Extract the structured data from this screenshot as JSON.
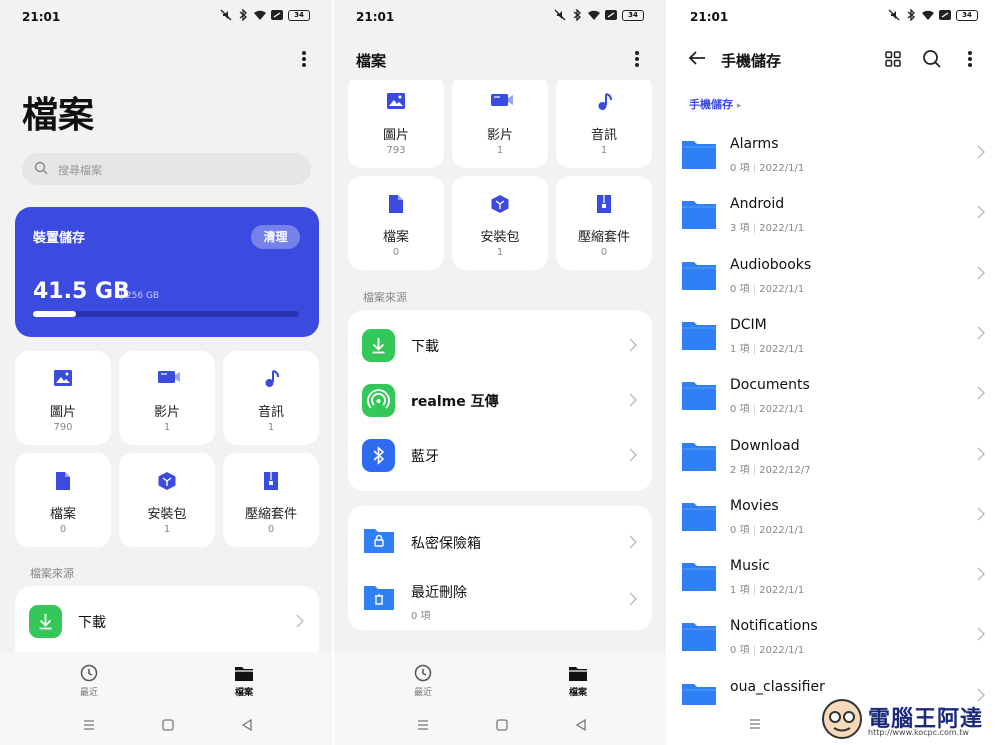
{
  "status": {
    "time": "21:01",
    "battery": "34"
  },
  "colors": {
    "accent": "#3b4be0",
    "green": "#34c759",
    "blue": "#2f6bf0",
    "folder": "#2f7ff5"
  },
  "files_home": {
    "title": "檔案",
    "search_placeholder": "搜尋檔案",
    "storage": {
      "label": "裝置儲存",
      "clean": "清理",
      "used": "41.5 GB",
      "total": "256 GB",
      "used_fraction": 0.162
    },
    "categories": [
      {
        "label": "圖片",
        "count": "790",
        "icon": "image-icon"
      },
      {
        "label": "影片",
        "count": "1",
        "icon": "video-icon"
      },
      {
        "label": "音訊",
        "count": "1",
        "icon": "music-note-icon"
      },
      {
        "label": "檔案",
        "count": "0",
        "icon": "document-icon"
      },
      {
        "label": "安裝包",
        "count": "1",
        "icon": "package-icon"
      },
      {
        "label": "壓縮套件",
        "count": "0",
        "icon": "zip-icon"
      }
    ],
    "sources_heading": "檔案來源",
    "sources": [
      {
        "label": "下載",
        "icon": "download-icon"
      }
    ]
  },
  "files_scrolled": {
    "title": "檔案",
    "categories": [
      {
        "label": "圖片",
        "count": "793",
        "icon": "image-icon"
      },
      {
        "label": "影片",
        "count": "1",
        "icon": "video-icon"
      },
      {
        "label": "音訊",
        "count": "1",
        "icon": "music-note-icon"
      },
      {
        "label": "檔案",
        "count": "0",
        "icon": "document-icon"
      },
      {
        "label": "安裝包",
        "count": "1",
        "icon": "package-icon"
      },
      {
        "label": "壓縮套件",
        "count": "0",
        "icon": "zip-icon"
      }
    ],
    "sources_heading": "檔案來源",
    "sources": [
      {
        "label": "下載",
        "icon": "download-icon"
      },
      {
        "label": "realme 互傳",
        "icon": "share-icon"
      },
      {
        "label": "藍牙",
        "icon": "bluetooth-icon"
      }
    ],
    "extras": [
      {
        "label": "私密保險箱",
        "sub": "",
        "icon": "lock-folder-icon"
      },
      {
        "label": "最近刪除",
        "sub": "0 項",
        "icon": "trash-folder-icon"
      }
    ]
  },
  "nav": {
    "recent": "最近",
    "files": "檔案"
  },
  "phone_storage": {
    "title": "手機儲存",
    "breadcrumb": "手機儲存",
    "folders": [
      {
        "name": "Alarms",
        "count": "0 項",
        "date": "2022/1/1"
      },
      {
        "name": "Android",
        "count": "3 項",
        "date": "2022/1/1"
      },
      {
        "name": "Audiobooks",
        "count": "0 項",
        "date": "2022/1/1"
      },
      {
        "name": "DCIM",
        "count": "1 項",
        "date": "2022/1/1"
      },
      {
        "name": "Documents",
        "count": "0 項",
        "date": "2022/1/1"
      },
      {
        "name": "Download",
        "count": "2 項",
        "date": "2022/12/7"
      },
      {
        "name": "Movies",
        "count": "0 項",
        "date": "2022/1/1"
      },
      {
        "name": "Music",
        "count": "1 項",
        "date": "2022/1/1"
      },
      {
        "name": "Notifications",
        "count": "0 項",
        "date": "2022/1/1"
      },
      {
        "name": "oua_classifier",
        "count": "",
        "date": ""
      }
    ]
  },
  "watermark": {
    "text": "電腦王阿達",
    "url": "http://www.kocpc.com.tw"
  }
}
